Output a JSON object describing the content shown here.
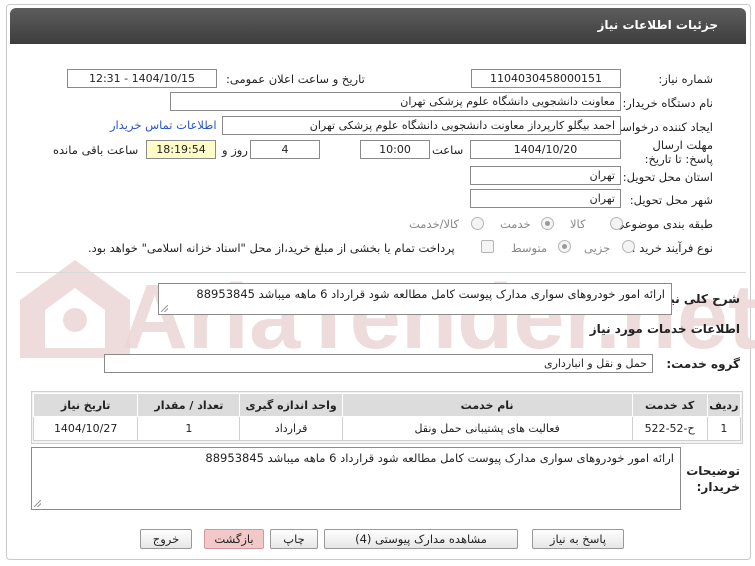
{
  "header": {
    "title": "جزئیات اطلاعات نیاز"
  },
  "form": {
    "need_number_label": "شماره نیاز:",
    "need_number": "1104030458000151",
    "announce_label": "تاریخ و ساعت اعلان عمومی:",
    "announce_value": "1404/10/15 - 12:31",
    "buyer_org_label": "نام دستگاه خریدار:",
    "buyer_org": "معاونت دانشجویی دانشگاه علوم پزشکی تهران",
    "requester_label": "ایجاد کننده درخواست:",
    "requester": "احمد بیگلو کارپرداز معاونت دانشجویی دانشگاه علوم پزشکی تهران",
    "contact_link": "اطلاعات تماس خریدار",
    "deadline_label": "مهلت ارسال پاسخ: تا تاریخ:",
    "deadline_date": "1404/10/20",
    "time_label": "ساعت",
    "deadline_time": "10:00",
    "days_value": "4",
    "days_label": "روز و",
    "remaining_time": "18:19:54",
    "remaining_label": "ساعت باقی مانده",
    "province_label": "استان محل تحویل:",
    "province": "تهران",
    "city_label": "شهر محل تحویل:",
    "city": "تهران",
    "category_label": "طبقه بندی موضوعی:",
    "category_options": [
      "کالا",
      "خدمت",
      "کالا/خدمت"
    ],
    "category_selected": "خدمت",
    "process_label": "نوع فرآیند خرید :",
    "process_options": [
      "جزیی",
      "متوسط"
    ],
    "process_selected": "متوسط",
    "payment_note": "پرداخت تمام یا بخشی از مبلغ خرید،از محل \"اسناد خزانه اسلامی\" خواهد بود."
  },
  "summary": {
    "label": "شرح کلی نیاز:",
    "text": "ارائه امور خودروهای سواری مدارک پیوست کامل مطالعه شود قرارداد 6 ماهه میباشد 88953845"
  },
  "services": {
    "section_title": "اطلاعات خدمات مورد نیاز",
    "group_label": "گروه خدمت:",
    "group_value": "حمل و نقل و انبارداری",
    "columns": [
      "ردیف",
      "کد خدمت",
      "نام خدمت",
      "واحد اندازه گیری",
      "تعداد / مقدار",
      "تاریخ نیاز"
    ],
    "rows": [
      [
        "1",
        "ح-52-522",
        "فعالیت های پشتیبانی حمل ونقل",
        "قرارداد",
        "1",
        "1404/10/27"
      ]
    ]
  },
  "buyer_notes": {
    "label": "توضیحات خریدار:",
    "text": "ارائه امور خودروهای سواری مدارک پیوست کامل مطالعه شود قرارداد 6 ماهه میباشد 88953845"
  },
  "buttons": {
    "reply": "پاسخ به نیاز",
    "attachments": "مشاهده مدارک پیوستی (4)",
    "print": "چاپ",
    "back": "بازگشت",
    "exit": "خروج"
  },
  "watermark": {
    "text": "AriaTender.net"
  },
  "colors": {
    "titlebar": "#4a4a4a",
    "link": "#2a55c8",
    "remaining_bg": "#fffcc8",
    "watermark": "#e9d2d2"
  }
}
